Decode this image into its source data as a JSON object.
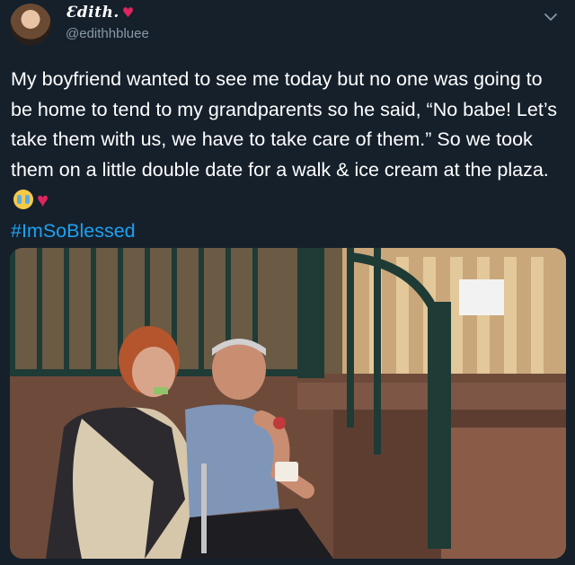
{
  "user": {
    "display_name": "Ɛdith.",
    "handle": "@edithhbluee",
    "name_heart": "♥"
  },
  "tweet": {
    "text": "My boyfriend wanted to see me today but no one was going to be home to tend to my grandparents so he said, “No babe! Let’s take them with us, we have to take care of them.” So we took them on a little double date for a walk & ice cream at the plaza.",
    "heart": "♥",
    "hashtag": "#ImSoBlessed"
  },
  "icons": {
    "menu": "chevron-down-icon",
    "crying_emoji": "loudly-crying-face-icon",
    "heart_emoji": "red-heart-icon"
  },
  "colors": {
    "background": "#15202b",
    "text": "#ffffff",
    "secondary_text": "#8899a6",
    "hashtag": "#1da1f2",
    "heart": "#e0245e"
  }
}
